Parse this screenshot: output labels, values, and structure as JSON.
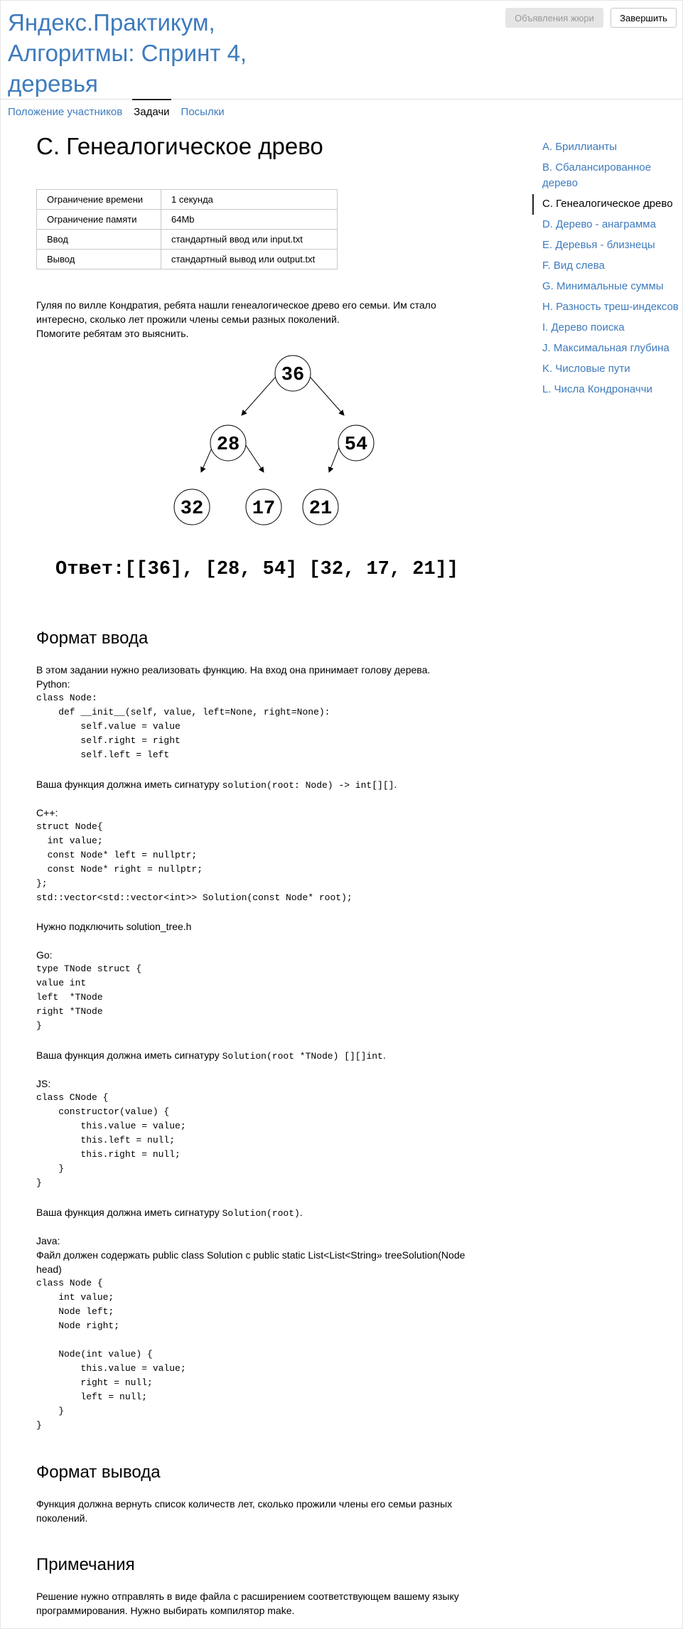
{
  "header": {
    "contest_title": "Яндекс.Практикум, Алгоритмы: Спринт 4, деревья",
    "announcements_button": "Объявления жюри",
    "finish_button": "Завершить"
  },
  "tabs": [
    {
      "label": "Положение участников"
    },
    {
      "label": "Задачи"
    },
    {
      "label": "Посылки"
    }
  ],
  "problem": {
    "title": "C. Генеалогическое древо",
    "limits": [
      {
        "key": "Ограничение времени",
        "value": "1 секунда"
      },
      {
        "key": "Ограничение памяти",
        "value": "64Mb"
      },
      {
        "key": "Ввод",
        "value": "стандартный ввод или input.txt"
      },
      {
        "key": "Вывод",
        "value": "стандартный вывод или output.txt"
      }
    ],
    "statement_line1": "Гуляя по вилле Кондратия, ребята нашли генеалогическое древо его семьи. Им стало интересно, сколько лет прожили члены семьи разных поколений.",
    "statement_line2": "Помогите ребятам это выяснить.",
    "tree_nodes": {
      "root": "36",
      "l": "28",
      "r": "54",
      "ll": "32",
      "lr": "17",
      "rl": "21"
    },
    "answer": "Ответ:[[36], [28, 54] [32, 17, 21]]"
  },
  "input_format": {
    "heading": "Формат ввода",
    "intro": "В этом задании нужно реализовать функцию. На вход она принимает голову дерева.",
    "python_label": "Python:",
    "python_code": "class Node:\n    def __init__(self, value, left=None, right=None):\n        self.value = value\n        self.right = right\n        self.left = left",
    "python_sig_prefix": "Ваша функция должна иметь сигнатуру ",
    "python_sig_code": "solution(root: Node) -> int[][]",
    "python_sig_suffix": ".",
    "cpp_label": "C++:",
    "cpp_code": "struct Node{\n  int value;\n  const Node* left = nullptr;\n  const Node* right = nullptr;\n};\nstd::vector<std::vector<int>> Solution(const Node* root);",
    "cpp_note": "Нужно подключить solution_tree.h",
    "go_label": "Go:",
    "go_code": "type TNode struct {\nvalue int\nleft  *TNode\nright *TNode\n}",
    "go_sig_prefix": "Ваша функция должна иметь сигнатуру ",
    "go_sig_code": "Solution(root *TNode) [][]int",
    "go_sig_suffix": ".",
    "js_label": "JS:",
    "js_code": "class CNode {\n    constructor(value) {\n        this.value = value;\n        this.left = null;\n        this.right = null;\n    }\n}",
    "js_sig_prefix": "Ваша функция должна иметь сигнатуру ",
    "js_sig_code": "Solution(root)",
    "js_sig_suffix": ".",
    "java_label": "Java:",
    "java_note": "Файл должен содержать public class Solution с public static List<List<String» treeSolution(Node head)",
    "java_code": "class Node {\n    int value;\n    Node left;\n    Node right;\n\n    Node(int value) {\n        this.value = value;\n        right = null;\n        left = null;\n    }\n}"
  },
  "output_format": {
    "heading": "Формат вывода",
    "text": "Функция должна вернуть список количеств лет, сколько прожили члены его семьи разных поколений."
  },
  "notes": {
    "heading": "Примечания",
    "text": "Решение нужно отправлять в виде файла с расширением соответствующем вашему языку программирования. Нужно выбирать компилятор make."
  },
  "sidebar": {
    "items": [
      {
        "label": "A. Бриллианты"
      },
      {
        "label": "B. Сбалансированное дерево"
      },
      {
        "label": "C. Генеалогическое древо"
      },
      {
        "label": "D. Дерево - анаграмма"
      },
      {
        "label": "E. Деревья - близнецы"
      },
      {
        "label": "F. Вид слева"
      },
      {
        "label": "G. Минимальные суммы"
      },
      {
        "label": "H. Разность треш-индексов"
      },
      {
        "label": "I. Дерево поиска"
      },
      {
        "label": "J. Максимальная глубина"
      },
      {
        "label": "K. Числовые пути"
      },
      {
        "label": "L. Числа Кондроначчи"
      }
    ],
    "active_index": 2
  },
  "colors": {
    "link": "#3e7bbd",
    "border": "#c8c8c8"
  }
}
